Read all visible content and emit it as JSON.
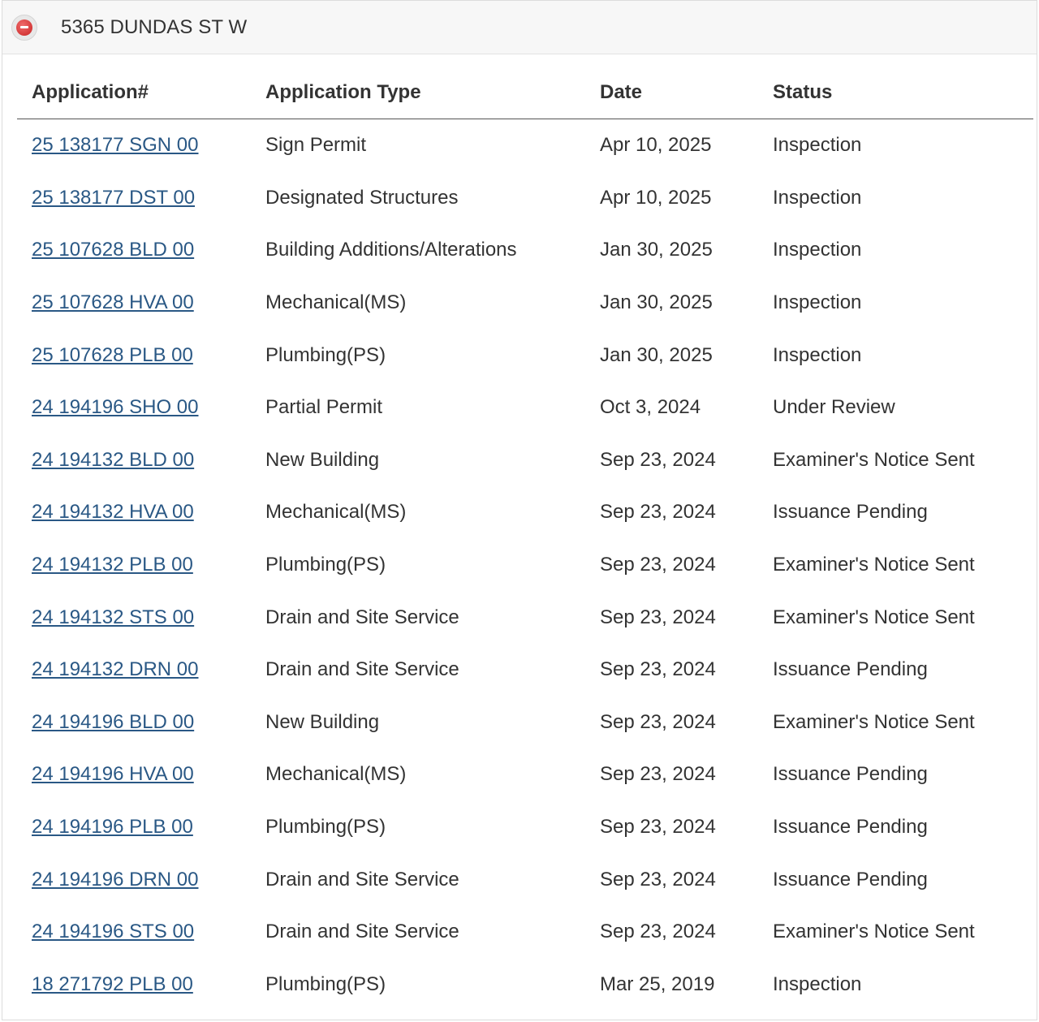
{
  "header": {
    "collapse_icon": "minus-circle-icon",
    "address": "5365 DUNDAS ST W"
  },
  "table": {
    "columns": [
      "Application#",
      "Application Type",
      "Date",
      "Status"
    ],
    "rows": [
      {
        "app": "25 138177 SGN 00",
        "type": "Sign Permit",
        "date": "Apr 10, 2025",
        "status": "Inspection"
      },
      {
        "app": "25 138177 DST 00",
        "type": "Designated Structures",
        "date": "Apr 10, 2025",
        "status": "Inspection"
      },
      {
        "app": "25 107628 BLD 00",
        "type": "Building Additions/Alterations",
        "date": "Jan 30, 2025",
        "status": "Inspection"
      },
      {
        "app": "25 107628 HVA 00",
        "type": "Mechanical(MS)",
        "date": "Jan 30, 2025",
        "status": "Inspection"
      },
      {
        "app": "25 107628 PLB 00",
        "type": "Plumbing(PS)",
        "date": "Jan 30, 2025",
        "status": "Inspection"
      },
      {
        "app": "24 194196 SHO 00",
        "type": "Partial Permit",
        "date": "Oct 3, 2024",
        "status": "Under Review"
      },
      {
        "app": "24 194132 BLD 00",
        "type": "New Building",
        "date": "Sep 23, 2024",
        "status": "Examiner's Notice Sent"
      },
      {
        "app": "24 194132 HVA 00",
        "type": "Mechanical(MS)",
        "date": "Sep 23, 2024",
        "status": "Issuance Pending"
      },
      {
        "app": "24 194132 PLB 00",
        "type": "Plumbing(PS)",
        "date": "Sep 23, 2024",
        "status": "Examiner's Notice Sent"
      },
      {
        "app": "24 194132 STS 00",
        "type": "Drain and Site Service",
        "date": "Sep 23, 2024",
        "status": "Examiner's Notice Sent"
      },
      {
        "app": "24 194132 DRN 00",
        "type": "Drain and Site Service",
        "date": "Sep 23, 2024",
        "status": "Issuance Pending"
      },
      {
        "app": "24 194196 BLD 00",
        "type": "New Building",
        "date": "Sep 23, 2024",
        "status": "Examiner's Notice Sent"
      },
      {
        "app": "24 194196 HVA 00",
        "type": "Mechanical(MS)",
        "date": "Sep 23, 2024",
        "status": "Issuance Pending"
      },
      {
        "app": "24 194196 PLB 00",
        "type": "Plumbing(PS)",
        "date": "Sep 23, 2024",
        "status": "Issuance Pending"
      },
      {
        "app": "24 194196 DRN 00",
        "type": "Drain and Site Service",
        "date": "Sep 23, 2024",
        "status": "Issuance Pending"
      },
      {
        "app": "24 194196 STS 00",
        "type": "Drain and Site Service",
        "date": "Sep 23, 2024",
        "status": "Examiner's Notice Sent"
      },
      {
        "app": "18 271792 PLB 00",
        "type": "Plumbing(PS)",
        "date": "Mar 25, 2019",
        "status": "Inspection"
      }
    ]
  },
  "colors": {
    "link": "#2a5885",
    "text": "#333333",
    "header_bg": "#f7f7f7",
    "collapse_red": "#c92222"
  }
}
